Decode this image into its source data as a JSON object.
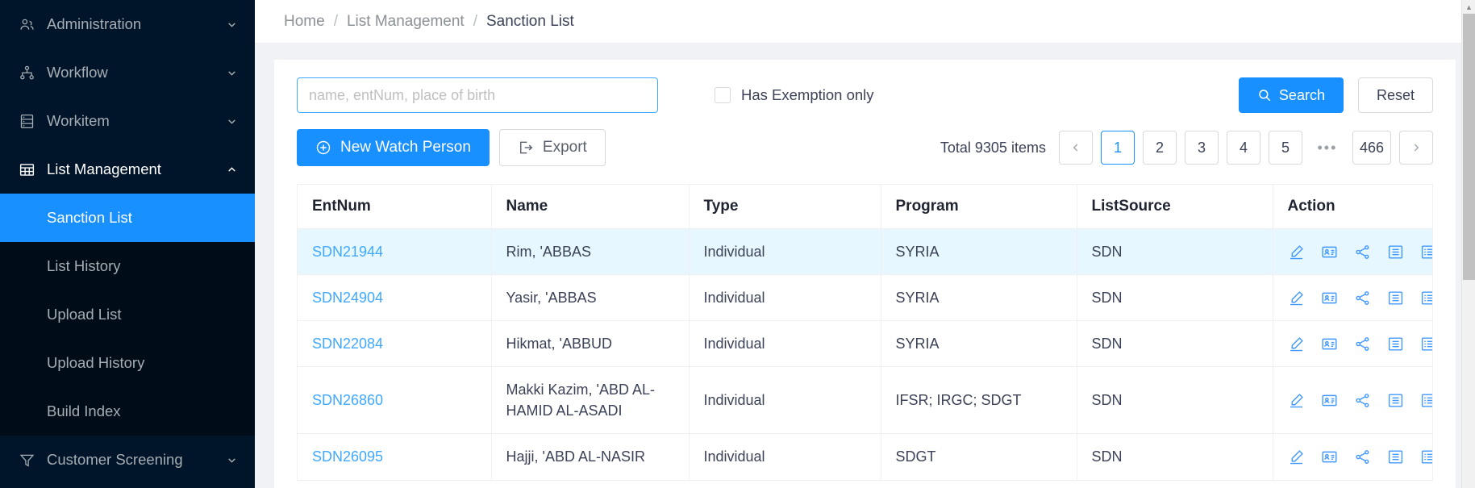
{
  "sidebar": {
    "groups": [
      {
        "label": "Administration",
        "icon": "users-icon",
        "chevron": "chevron-down-icon",
        "expanded": false
      },
      {
        "label": "Workflow",
        "icon": "workflow-icon",
        "chevron": "chevron-down-icon",
        "expanded": false
      },
      {
        "label": "Workitem",
        "icon": "server-icon",
        "chevron": "chevron-down-icon",
        "expanded": false
      },
      {
        "label": "List Management",
        "icon": "table-icon",
        "chevron": "chevron-up-icon",
        "expanded": true
      },
      {
        "label": "Customer Screening",
        "icon": "funnel-icon",
        "chevron": "chevron-down-icon",
        "expanded": false
      }
    ],
    "sub_items": [
      {
        "label": "Sanction List",
        "selected": true
      },
      {
        "label": "List History",
        "selected": false
      },
      {
        "label": "Upload List",
        "selected": false
      },
      {
        "label": "Upload History",
        "selected": false
      },
      {
        "label": "Build Index",
        "selected": false
      }
    ]
  },
  "breadcrumb": {
    "items": [
      "Home",
      "List Management",
      "Sanction List"
    ],
    "separator": "/"
  },
  "filter": {
    "search_value": "",
    "search_placeholder": "name, entNum, place of birth",
    "checkbox_label": "Has Exemption only",
    "checkbox_checked": false,
    "search_button": "Search",
    "search_icon": "search-icon",
    "reset_button": "Reset"
  },
  "toolbar": {
    "new_label": "New Watch Person",
    "new_icon": "plus-circle-icon",
    "export_label": "Export",
    "export_icon": "export-icon"
  },
  "pagination": {
    "total_text": "Total 9305 items",
    "prev_icon": "chevron-left-icon",
    "next_icon": "chevron-right-icon",
    "pages": [
      "1",
      "2",
      "3",
      "4",
      "5"
    ],
    "ellipsis": "•••",
    "last_page": "466",
    "current_page": "1"
  },
  "table": {
    "columns": [
      "EntNum",
      "Name",
      "Type",
      "Program",
      "ListSource",
      "Action"
    ],
    "action_icons": [
      "edit-icon",
      "id-card-icon",
      "share-icon",
      "list-detail-icon",
      "list-alt-icon"
    ],
    "rows": [
      {
        "entnum": "SDN21944",
        "name": "Rim, 'ABBAS",
        "type": "Individual",
        "program": "SYRIA",
        "listsource": "SDN",
        "highlighted": true
      },
      {
        "entnum": "SDN24904",
        "name": "Yasir, 'ABBAS",
        "type": "Individual",
        "program": "SYRIA",
        "listsource": "SDN",
        "highlighted": false
      },
      {
        "entnum": "SDN22084",
        "name": "Hikmat, 'ABBUD",
        "type": "Individual",
        "program": "SYRIA",
        "listsource": "SDN",
        "highlighted": false
      },
      {
        "entnum": "SDN26860",
        "name": "Makki Kazim, 'ABD AL-HAMID AL-ASADI",
        "type": "Individual",
        "program": "IFSR; IRGC; SDGT",
        "listsource": "SDN",
        "highlighted": false
      },
      {
        "entnum": "SDN26095",
        "name": "Hajji, 'ABD AL-NASIR",
        "type": "Individual",
        "program": "SDGT",
        "listsource": "SDN",
        "highlighted": false
      }
    ]
  },
  "colors": {
    "accent": "#1890ff",
    "sidebar_bg": "#001529",
    "sidebar_sub_bg": "#000c17",
    "row_highlight": "#e6f7ff",
    "link": "#40a9ff"
  }
}
